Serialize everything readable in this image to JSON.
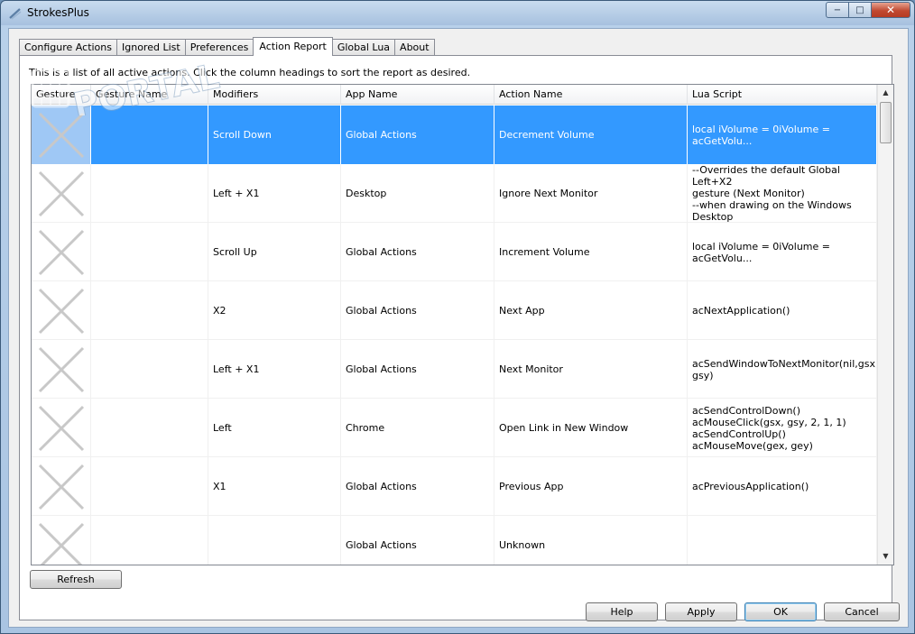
{
  "window": {
    "title": "StrokesPlus",
    "controls": {
      "minimize": "−",
      "maximize": "□",
      "close": "✕"
    }
  },
  "tabs": [
    {
      "label": "Configure Actions",
      "active": false
    },
    {
      "label": "Ignored List",
      "active": false
    },
    {
      "label": "Preferences",
      "active": false
    },
    {
      "label": "Action Report",
      "active": true
    },
    {
      "label": "Global Lua",
      "active": false
    },
    {
      "label": "About",
      "active": false
    }
  ],
  "report": {
    "hint": "This is a list of all active actions.  Click the column headings to sort the report as desired.",
    "columns": [
      "Gesture",
      "Gesture Name",
      "Modifiers",
      "App Name",
      "Action Name",
      "Lua Script"
    ],
    "rows": [
      {
        "gesture_icon": "x-gesture-icon",
        "gesture_name": "",
        "modifiers": "Scroll Down",
        "app_name": "Global Actions",
        "action_name": "Decrement Volume",
        "lua_script": "local iVolume = 0iVolume = acGetVolu...",
        "selected": true
      },
      {
        "gesture_icon": "x-gesture-icon",
        "gesture_name": "",
        "modifiers": "Left + X1",
        "app_name": "Desktop",
        "action_name": "Ignore Next Monitor",
        "lua_script": "--Overrides the default Global Left+X2\ngesture (Next Monitor)\n--when drawing on the Windows\nDesktop",
        "selected": false
      },
      {
        "gesture_icon": "x-gesture-icon",
        "gesture_name": "",
        "modifiers": "Scroll Up",
        "app_name": "Global Actions",
        "action_name": "Increment Volume",
        "lua_script": "local iVolume = 0iVolume = acGetVolu...",
        "selected": false
      },
      {
        "gesture_icon": "x-gesture-icon",
        "gesture_name": "",
        "modifiers": "X2",
        "app_name": "Global Actions",
        "action_name": "Next App",
        "lua_script": "acNextApplication()",
        "selected": false
      },
      {
        "gesture_icon": "x-gesture-icon",
        "gesture_name": "",
        "modifiers": "Left + X1",
        "app_name": "Global Actions",
        "action_name": "Next Monitor",
        "lua_script": "acSendWindowToNextMonitor(nil,gsx,\ngsy)",
        "selected": false
      },
      {
        "gesture_icon": "x-gesture-icon",
        "gesture_name": "",
        "modifiers": "Left",
        "app_name": "Chrome",
        "action_name": "Open Link in New Window",
        "lua_script": "acSendControlDown()\nacMouseClick(gsx, gsy, 2, 1, 1)\nacSendControlUp()\nacMouseMove(gex, gey)",
        "selected": false
      },
      {
        "gesture_icon": "x-gesture-icon",
        "gesture_name": "",
        "modifiers": "X1",
        "app_name": "Global Actions",
        "action_name": "Previous App",
        "lua_script": "acPreviousApplication()",
        "selected": false
      },
      {
        "gesture_icon": "x-gesture-icon",
        "gesture_name": "",
        "modifiers": "",
        "app_name": "Global Actions",
        "action_name": "Unknown",
        "lua_script": "",
        "selected": false
      }
    ]
  },
  "buttons": {
    "refresh": "Refresh",
    "help": "Help",
    "apply": "Apply",
    "ok": "OK",
    "cancel": "Cancel"
  },
  "watermark": {
    "text": "PORTAL"
  },
  "colors": {
    "selection": "#3399ff",
    "titlebar": "#b6cde6",
    "close_button": "#c14a32"
  }
}
